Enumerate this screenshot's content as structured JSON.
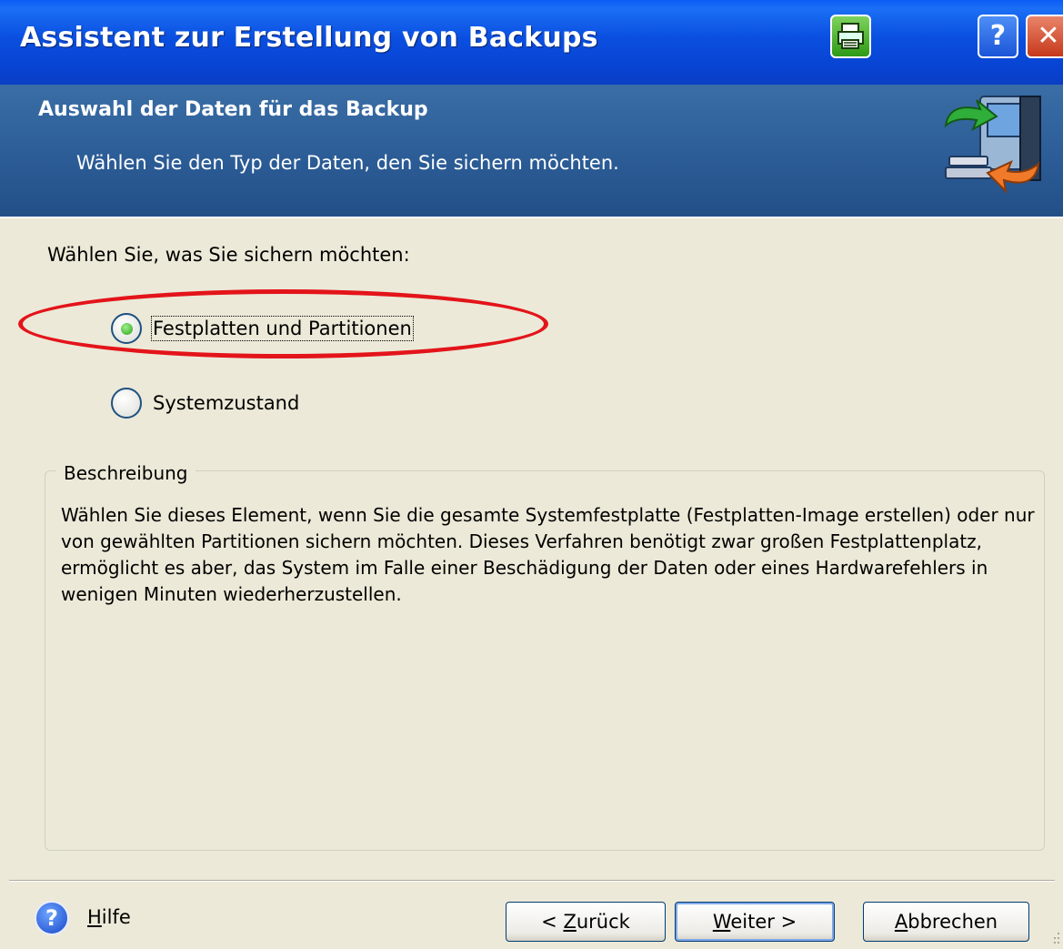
{
  "window": {
    "title": "Assistent zur Erstellung von Backups",
    "icons": {
      "print": "print-icon",
      "help": "help-icon",
      "close": "close-icon"
    },
    "colors": {
      "titlebar": "#0a4fe0",
      "header": "#2d5e98",
      "dialog_bg": "#ece9d8",
      "highlight": "#e3141a"
    }
  },
  "header": {
    "title": "Auswahl der Daten für das Backup",
    "subtitle": "Wählen Sie den Typ der Daten, den Sie sichern möchten.",
    "icon": "backup-computer-icon"
  },
  "content": {
    "prompt": "Wählen Sie, was Sie sichern möchten:",
    "options": [
      {
        "label": "Festplatten und Partitionen",
        "selected": true
      },
      {
        "label": "Systemzustand",
        "selected": false
      }
    ],
    "description": {
      "title": "Beschreibung",
      "text": "Wählen Sie dieses Element, wenn Sie die gesamte Systemfestplatte (Festplatten-Image erstellen) oder nur von gewählten Partitionen sichern möchten. Dieses Verfahren benötigt zwar großen Festplattenplatz, ermöglicht es aber, das System im Falle einer Beschädigung der Daten oder eines Hardwarefehlers in wenigen Minuten wiederherzustellen."
    }
  },
  "footer": {
    "help": {
      "hotkey": "H",
      "rest": "ilfe",
      "icon": "question-circle-icon"
    },
    "buttons": {
      "back": {
        "prefix": "< ",
        "hotkey": "Z",
        "rest": "urück"
      },
      "next": {
        "prefix": "",
        "hotkey": "W",
        "rest": "eiter >"
      },
      "cancel": {
        "prefix": "",
        "hotkey": "A",
        "rest": "bbrechen"
      }
    }
  }
}
